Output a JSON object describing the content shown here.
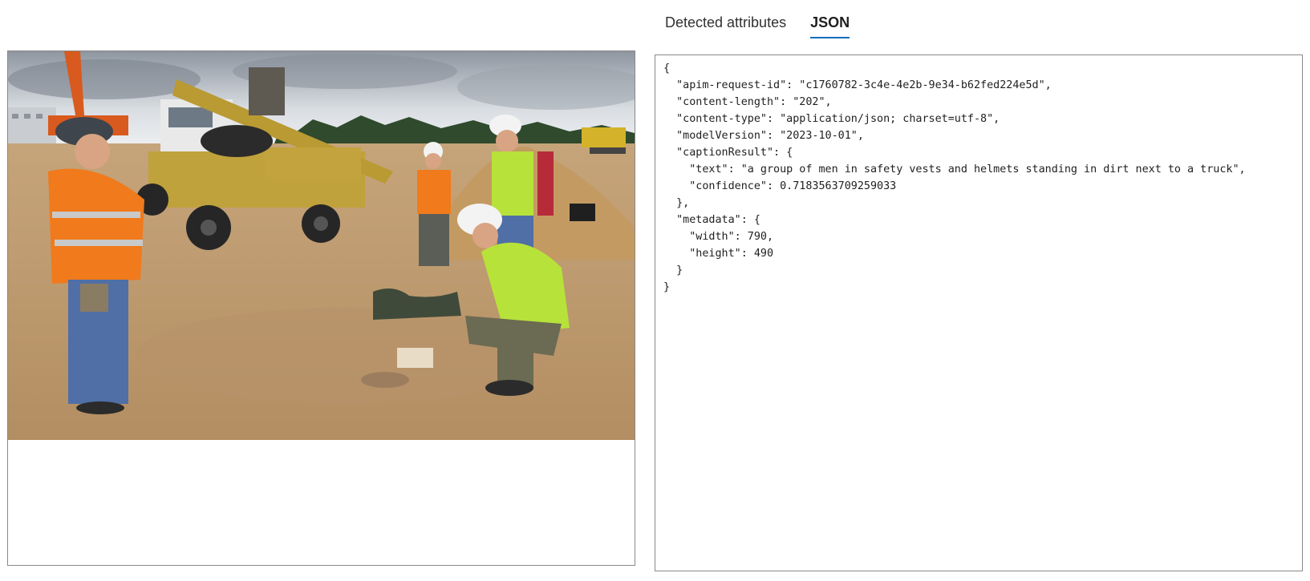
{
  "tabs": {
    "detected_label": "Detected attributes",
    "json_label": "JSON",
    "active": "JSON"
  },
  "json_view": {
    "lines": [
      "{",
      "  \"apim-request-id\": \"c1760782-3c4e-4e2b-9e34-b62fed224e5d\",",
      "  \"content-length\": \"202\",",
      "  \"content-type\": \"application/json; charset=utf-8\",",
      "  \"modelVersion\": \"2023-10-01\",",
      "  \"captionResult\": {",
      "    \"text\": \"a group of men in safety vests and helmets standing in dirt next to a truck\",",
      "    \"confidence\": 0.7183563709259033",
      "  },",
      "  \"metadata\": {",
      "    \"width\": 790,",
      "    \"height\": 490",
      "  }",
      "}"
    ]
  },
  "colors": {
    "tab_underline": "#0f6cbd",
    "border": "#8a8886"
  }
}
